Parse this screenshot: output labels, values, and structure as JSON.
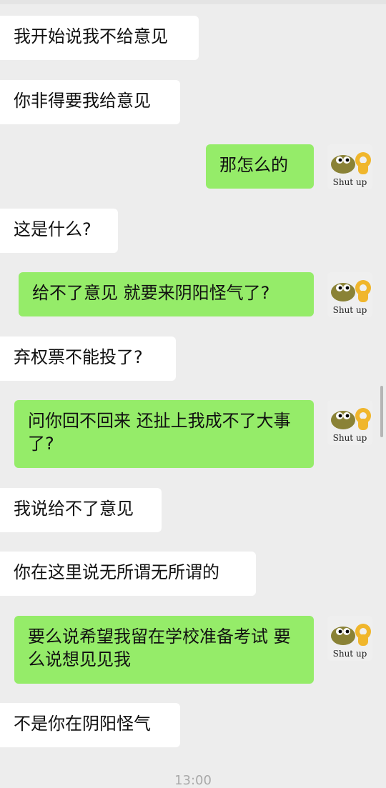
{
  "messages": [
    {
      "side": "left",
      "text": "我开始说我不给意见"
    },
    {
      "side": "left",
      "text": "你非得要我给意见"
    },
    {
      "side": "right",
      "text": "那怎么的"
    },
    {
      "side": "left",
      "text": "这是什么?"
    },
    {
      "side": "right",
      "text": "给不了意见 就要来阴阳怪气了?"
    },
    {
      "side": "left",
      "text": "弃权票不能投了?"
    },
    {
      "side": "right",
      "text": "问你回不回来 还扯上我成不了大事了?"
    },
    {
      "side": "left",
      "text": "我说给不了意见"
    },
    {
      "side": "left",
      "text": "你在这里说无所谓无所谓的"
    },
    {
      "side": "right",
      "text": "要么说希望我留在学校准备考试 要么说想见见我"
    },
    {
      "side": "left",
      "text": "不是你在阴阳怪气"
    }
  ],
  "avatar": {
    "caption": "Shut up",
    "icon": "teapot-ok-hand-icon"
  },
  "timestamp": "13:00",
  "colors": {
    "background": "#ededed",
    "incoming_bubble": "#ffffff",
    "outgoing_bubble": "#95ec69"
  }
}
